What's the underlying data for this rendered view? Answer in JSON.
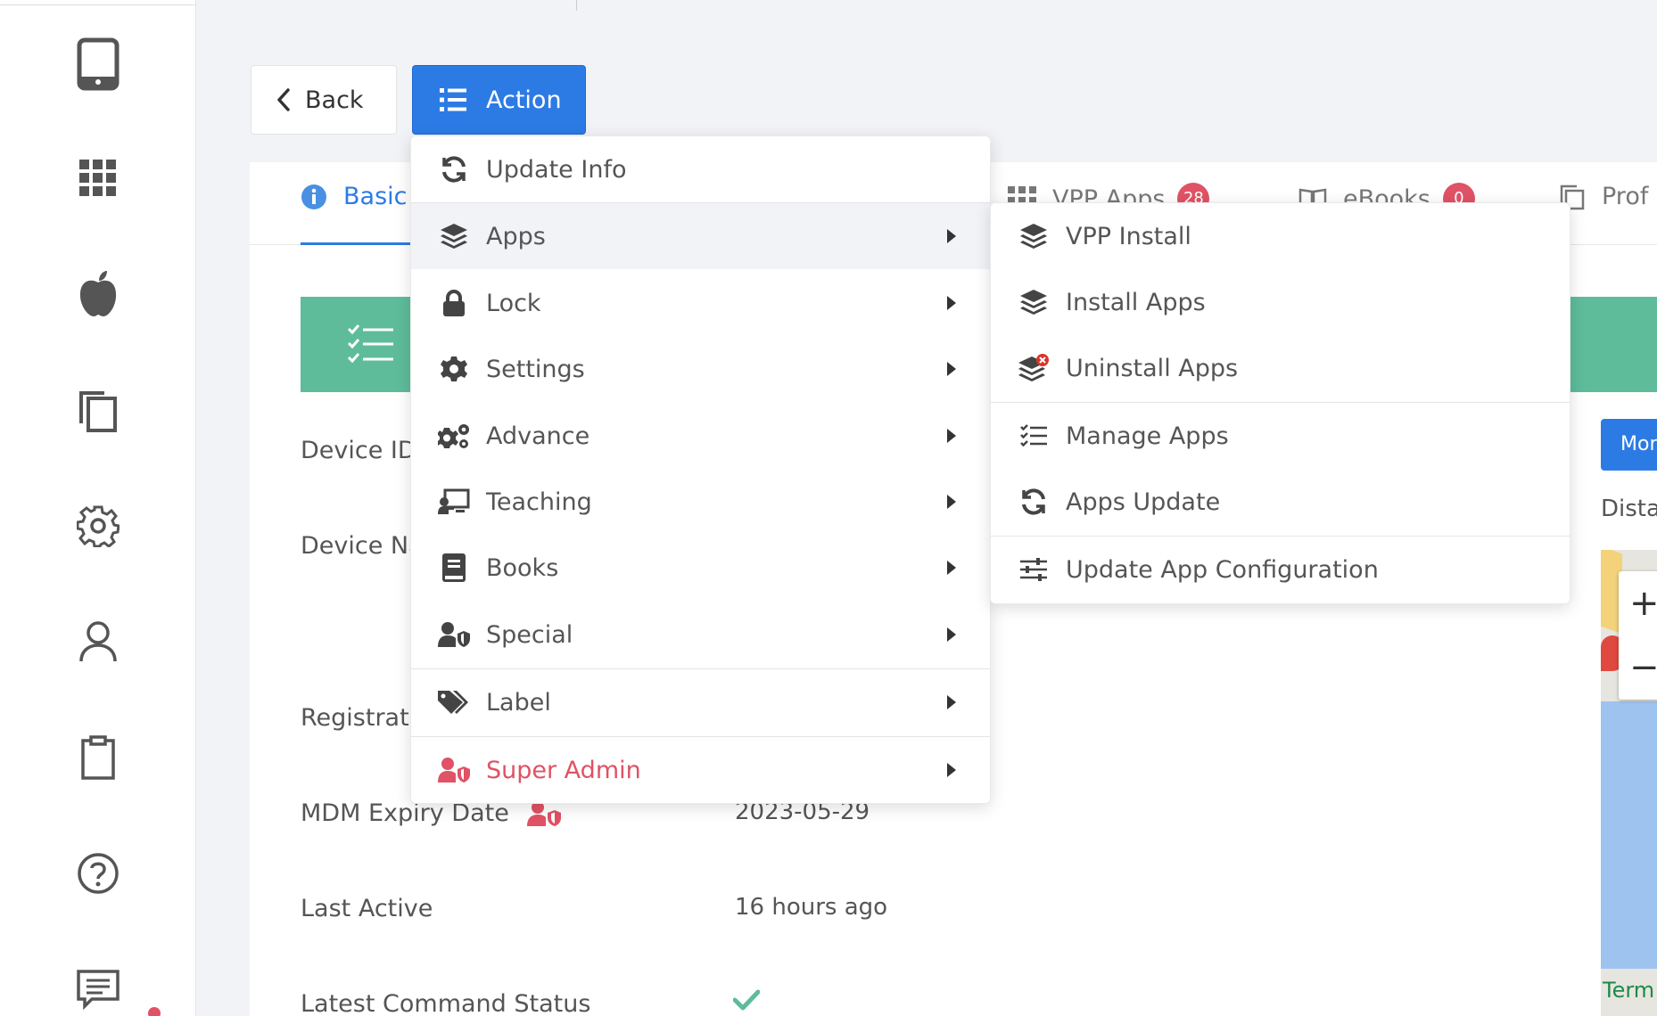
{
  "sidebar": {
    "items": [
      {
        "icon": "tablet-icon"
      },
      {
        "icon": "apps-grid-icon"
      },
      {
        "icon": "apple-icon"
      },
      {
        "icon": "copy-icon"
      },
      {
        "icon": "gear-icon"
      },
      {
        "icon": "user-icon"
      },
      {
        "icon": "clipboard-icon"
      },
      {
        "icon": "help-icon"
      },
      {
        "icon": "message-icon"
      }
    ]
  },
  "toolbar": {
    "back_label": "Back",
    "action_label": "Action"
  },
  "tabs": [
    {
      "label": "Basic",
      "icon": "info-icon",
      "active": true
    },
    {
      "label": "VPP Apps",
      "icon": "grid-icon",
      "badge": "28"
    },
    {
      "label": "eBooks",
      "icon": "book-open-icon",
      "badge": "0"
    },
    {
      "label": "Prof",
      "icon": "copy-icon"
    }
  ],
  "details": {
    "device_id_label": "Device ID",
    "device_name_label": "Device Na",
    "registration_label": "Registrati",
    "mdm_expiry_label": "MDM Expiry Date",
    "mdm_expiry_value": "2023-05-29",
    "last_active_label": "Last Active",
    "last_active_value": "16 hours ago",
    "latest_command_label": "Latest Command Status"
  },
  "right_panel": {
    "more_button": "Mor",
    "distance_label": "Dista",
    "map_label": "Term"
  },
  "action_menu": {
    "items": [
      {
        "label": "Update Info",
        "icon": "sync-icon",
        "submenu": false
      },
      {
        "label": "Apps",
        "icon": "layers-icon",
        "submenu": true,
        "highlighted": true
      },
      {
        "label": "Lock",
        "icon": "lock-icon",
        "submenu": true
      },
      {
        "label": "Settings",
        "icon": "gear-icon",
        "submenu": true
      },
      {
        "label": "Advance",
        "icon": "gears-icon",
        "submenu": true
      },
      {
        "label": "Teaching",
        "icon": "teaching-icon",
        "submenu": true
      },
      {
        "label": "Books",
        "icon": "book-icon",
        "submenu": true
      },
      {
        "label": "Special",
        "icon": "user-shield-icon",
        "submenu": true
      },
      {
        "label": "Label",
        "icon": "tags-icon",
        "submenu": true
      },
      {
        "label": "Super Admin",
        "icon": "user-shield-icon",
        "submenu": true,
        "color": "#e05265"
      }
    ]
  },
  "apps_submenu": {
    "items": [
      {
        "label": "VPP Install",
        "icon": "layers-icon"
      },
      {
        "label": "Install Apps",
        "icon": "layers-icon"
      },
      {
        "label": "Uninstall Apps",
        "icon": "layers-remove-icon"
      },
      {
        "label": "Manage Apps",
        "icon": "tasks-list-icon"
      },
      {
        "label": "Apps Update",
        "icon": "sync-icon"
      },
      {
        "label": "Update App Configuration",
        "icon": "sliders-icon"
      }
    ]
  },
  "colors": {
    "primary": "#2c7be5",
    "success": "#5ebc9b",
    "danger": "#e05265"
  }
}
